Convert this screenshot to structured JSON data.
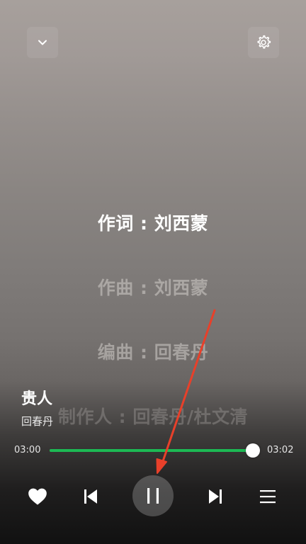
{
  "lyrics": [
    "作词 : 刘西蒙",
    "作曲 : 刘西蒙",
    "编曲 : 回春丹",
    "制作人 : 回春丹/杜文清"
  ],
  "track": {
    "title": "贵人",
    "artist": "回春丹"
  },
  "playback": {
    "current_time": "03:00",
    "total_time": "03:02",
    "progress_fraction": 0.989,
    "state": "playing"
  },
  "icons": {
    "collapse": "chevron-down-icon",
    "settings": "gear-icon",
    "like": "heart-icon",
    "previous": "skip-previous-icon",
    "pause": "pause-icon",
    "next": "skip-next-icon",
    "queue": "menu-icon"
  },
  "colors": {
    "accent": "#1db954",
    "annotation": "#e8402a"
  }
}
